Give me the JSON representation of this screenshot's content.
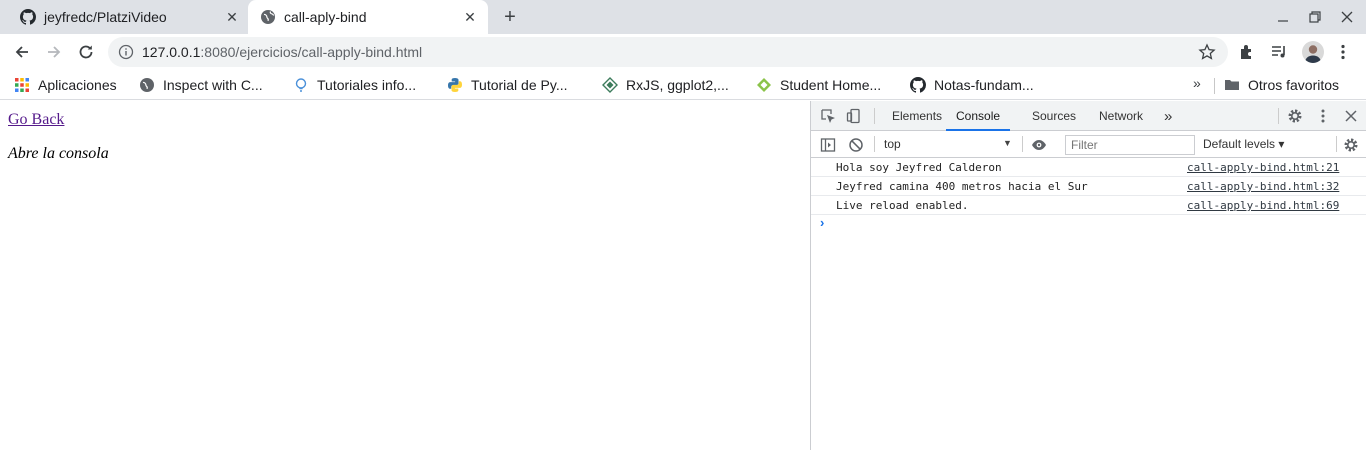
{
  "browser": {
    "tabs": [
      {
        "title": "jeyfredc/PlatziVideo",
        "favicon": "github-icon",
        "active": false
      },
      {
        "title": "call-aply-bind",
        "favicon": "globe-icon",
        "active": true
      }
    ],
    "address": {
      "host": "127.0.0.1",
      "path": ":8080/ejercicios/call-apply-bind.html"
    },
    "bookmarks": [
      {
        "label": "Aplicaciones",
        "icon": "apps-grid-icon"
      },
      {
        "label": "Inspect with C...",
        "icon": "globe-icon"
      },
      {
        "label": "Tutoriales info...",
        "icon": "bulb-icon"
      },
      {
        "label": "Tutorial de Py...",
        "icon": "python-icon"
      },
      {
        "label": "RxJS, ggplot2,...",
        "icon": "diamond-icon"
      },
      {
        "label": "Student Home...",
        "icon": "student-icon"
      },
      {
        "label": "Notas-fundam...",
        "icon": "github-icon"
      }
    ],
    "bookmarks_more": "»",
    "other_bookmarks": "Otros favoritos"
  },
  "page": {
    "link": "Go Back",
    "hint": "Abre la consola"
  },
  "devtools": {
    "tabs": [
      "Elements",
      "Console",
      "Sources",
      "Network"
    ],
    "active_tab": "Console",
    "more_tabs": "»",
    "context": "top",
    "filter_placeholder": "Filter",
    "levels": "Default levels ▾",
    "logs": [
      {
        "message": "Hola soy Jeyfred Calderon",
        "source": "call-apply-bind.html:21"
      },
      {
        "message": "Jeyfred camina 400 metros hacia el Sur",
        "source": "call-apply-bind.html:32"
      },
      {
        "message": "Live reload enabled.",
        "source": "call-apply-bind.html:69"
      }
    ],
    "prompt": "›"
  },
  "colors": {
    "accent": "#1a73e8",
    "tabstrip": "#dee1e6",
    "omnibox": "#f1f3f4",
    "link_visited": "#551a8b"
  }
}
